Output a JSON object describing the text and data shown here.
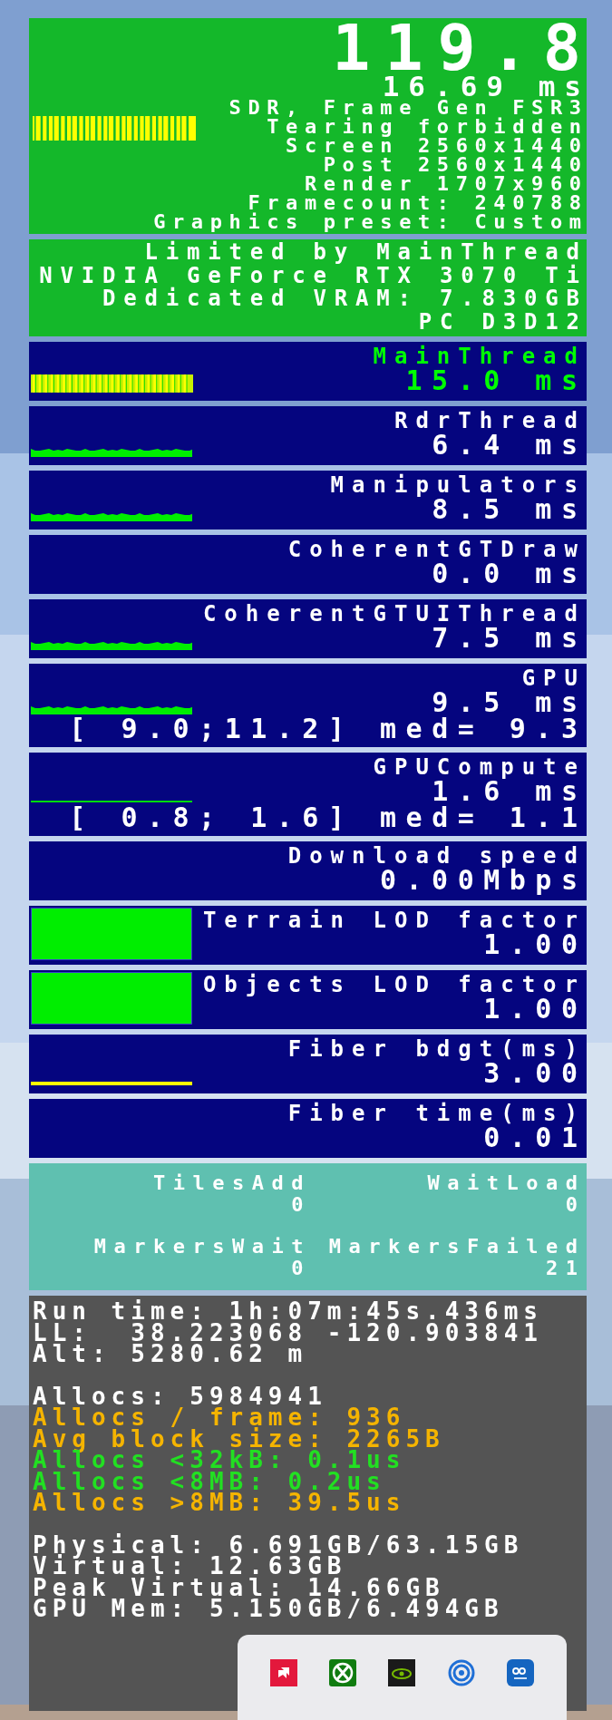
{
  "fps": {
    "value": "119.8",
    "frame_time": "16.69 ms",
    "lines": [
      "SDR, Frame Gen FSR3",
      "Tearing forbidden",
      "Screen 2560x1440",
      "Post 2560x1440",
      "Render 1707x960",
      "Framecount: 240788",
      "Graphics preset: Custom"
    ]
  },
  "system": [
    "Limited by MainThread",
    "NVIDIA GeForce RTX 3070 Ti",
    "Dedicated VRAM: 7.830GB",
    "PC D3D12"
  ],
  "stats": [
    {
      "label": "MainThread",
      "value": "15.0 ms",
      "kind": "bars",
      "highlighted": true
    },
    {
      "label": "RdrThread",
      "value": "6.4 ms",
      "kind": "area",
      "highlighted": false
    },
    {
      "label": "Manipulators",
      "value": "8.5 ms",
      "kind": "area",
      "highlighted": false
    },
    {
      "label": "CoherentGTDraw",
      "value": "0.0 ms",
      "kind": "plain",
      "highlighted": false
    },
    {
      "label": "CoherentGTUIThread",
      "value": "7.5 ms",
      "kind": "area",
      "highlighted": false
    },
    {
      "label": "GPU",
      "value": "9.5 ms",
      "extra": "[ 9.0;11.2] med= 9.3",
      "kind": "area",
      "highlighted": false
    },
    {
      "label": "GPUCompute",
      "value": "1.6 ms",
      "extra": "[ 0.8; 1.6] med= 1.1",
      "kind": "trace",
      "highlighted": false
    },
    {
      "label": "Download speed",
      "value": "0.00Mbps",
      "kind": "plain",
      "highlighted": false
    },
    {
      "label": "Terrain LOD factor",
      "value": "1.00",
      "kind": "meter",
      "highlighted": false
    },
    {
      "label": "Objects LOD factor",
      "value": "1.00",
      "kind": "meter",
      "highlighted": false
    },
    {
      "label": "Fiber bdgt(ms)",
      "value": "3.00",
      "kind": "flat",
      "highlighted": false
    },
    {
      "label": "Fiber time(ms)",
      "value": "0.01",
      "kind": "plain",
      "highlighted": false
    }
  ],
  "tiles": [
    {
      "label": "TilesAdd",
      "value": "0"
    },
    {
      "label": "WaitLoad",
      "value": "0"
    },
    {
      "label": "MarkersWait",
      "value": "0"
    },
    {
      "label": "MarkersFailed",
      "value": "21"
    }
  ],
  "memory": [
    [
      {
        "text": "Run time: 1h:07m:45s.436ms",
        "color": "#ffffff"
      },
      {
        "text": "LL:  38.223068 -120.903841",
        "color": "#ffffff"
      },
      {
        "text": "Alt: 5280.62 m",
        "color": "#ffffff"
      }
    ],
    [
      {
        "text": "Allocs: 5984941",
        "color": "#ffffff"
      },
      {
        "text": "Allocs / frame: 936",
        "color": "#f5b400"
      },
      {
        "text": "Avg block size: 2265B",
        "color": "#f5b400"
      },
      {
        "text": "Allocs <32kB: 0.1us",
        "color": "#22e022"
      },
      {
        "text": "Allocs <8MB: 0.2us",
        "color": "#22e022"
      },
      {
        "text": "Allocs >8MB: 39.5us",
        "color": "#f5b400"
      }
    ],
    [
      {
        "text": "Physical: 6.691GB/63.15GB",
        "color": "#ffffff"
      },
      {
        "text": "Virtual: 12.63GB",
        "color": "#ffffff"
      },
      {
        "text": "Peak Virtual: 14.66GB",
        "color": "#ffffff"
      },
      {
        "text": "GPU Mem: 5.150GB/6.494GB",
        "color": "#ffffff"
      }
    ]
  ]
}
